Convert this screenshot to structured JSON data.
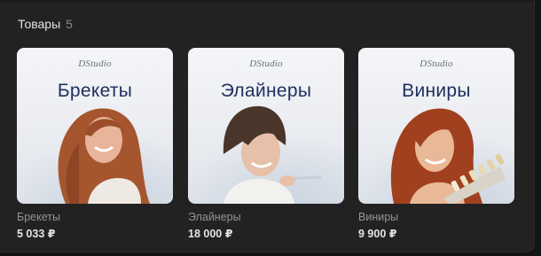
{
  "section": {
    "title": "Товары",
    "count": "5"
  },
  "brand": {
    "logo_text": "DStudio"
  },
  "products": [
    {
      "heading": "Брекеты",
      "name": "Брекеты",
      "price": "5 033 ₽"
    },
    {
      "heading": "Элайнеры",
      "name": "Элайнеры",
      "price": "18 000 ₽"
    },
    {
      "heading": "Виниры",
      "name": "Виниры",
      "price": "9 900 ₽"
    }
  ],
  "colors": {
    "panel_bg": "#222222",
    "heading_blue": "#1f3060",
    "caption_gray": "#939599",
    "price_white": "#e1e3e6"
  }
}
